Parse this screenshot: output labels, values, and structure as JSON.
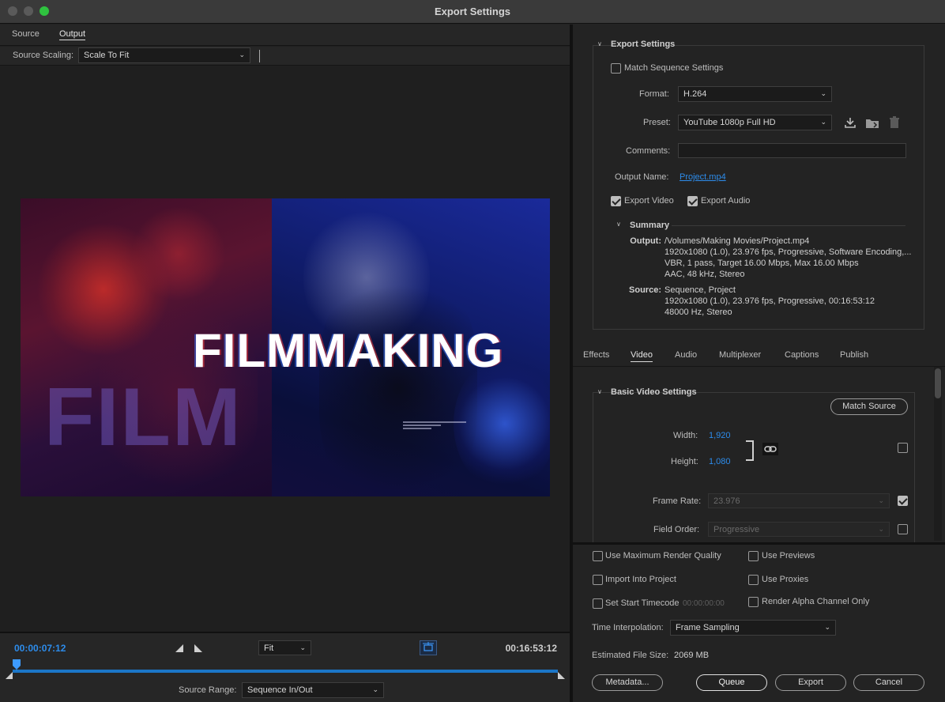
{
  "window": {
    "title": "Export Settings"
  },
  "left": {
    "tabs": [
      {
        "label": "Source"
      },
      {
        "label": "Output"
      }
    ],
    "source_scaling_label": "Source Scaling:",
    "source_scaling_value": "Scale To Fit",
    "preview": {
      "title_text": "FILMMAKING",
      "bg_text": "FILM"
    },
    "timeline": {
      "current_timecode": "00:00:07:12",
      "duration_timecode": "00:16:53:12",
      "zoom_value": "Fit",
      "playhead_progress": 0.007
    },
    "source_range_label": "Source Range:",
    "source_range_value": "Sequence In/Out"
  },
  "export_settings": {
    "section_title": "Export Settings",
    "match_sequence_label": "Match Sequence Settings",
    "format_label": "Format:",
    "format_value": "H.264",
    "preset_label": "Preset:",
    "preset_value": "YouTube 1080p Full HD",
    "comments_label": "Comments:",
    "comments_value": "",
    "output_name_label": "Output Name:",
    "output_name_value": "Project.mp4",
    "export_video_label": "Export Video",
    "export_audio_label": "Export Audio",
    "summary_title": "Summary",
    "summary_output_key": "Output:",
    "summary_output_lines": [
      "/Volumes/Making Movies/Project.mp4",
      "1920x1080 (1.0), 23.976 fps, Progressive, Software Encoding,...",
      "VBR, 1 pass, Target 16.00 Mbps, Max 16.00 Mbps",
      "AAC, 48 kHz, Stereo"
    ],
    "summary_source_key": "Source:",
    "summary_source_lines": [
      "Sequence, Project",
      "1920x1080 (1.0), 23.976 fps, Progressive, 00:16:53:12",
      "48000 Hz, Stereo"
    ]
  },
  "settings_tabs": [
    {
      "label": "Effects"
    },
    {
      "label": "Video"
    },
    {
      "label": "Audio"
    },
    {
      "label": "Multiplexer"
    },
    {
      "label": "Captions"
    },
    {
      "label": "Publish"
    }
  ],
  "basic_video": {
    "section_title": "Basic Video Settings",
    "match_source_label": "Match Source",
    "width_label": "Width:",
    "width_value": "1,920",
    "height_label": "Height:",
    "height_value": "1,080",
    "frame_rate_label": "Frame Rate:",
    "frame_rate_value": "23.976",
    "field_order_label": "Field Order:",
    "field_order_value": "Progressive"
  },
  "bottom": {
    "use_max_render_quality": "Use Maximum Render Quality",
    "use_previews": "Use Previews",
    "import_into_project": "Import Into Project",
    "use_proxies": "Use Proxies",
    "set_start_timecode": "Set Start Timecode",
    "start_timecode_value": "00:00:00:00",
    "render_alpha_only": "Render Alpha Channel Only",
    "time_interpolation_label": "Time Interpolation:",
    "time_interpolation_value": "Frame Sampling",
    "estimated_file_size_label": "Estimated File Size:",
    "estimated_file_size_value": "2069 MB",
    "metadata_button": "Metadata...",
    "queue_button": "Queue",
    "export_button": "Export",
    "cancel_button": "Cancel"
  },
  "colors": {
    "accent_blue": "#2d8ceb",
    "traffic_green": "#2fc23f",
    "timeline_track": "#1b76c8"
  }
}
